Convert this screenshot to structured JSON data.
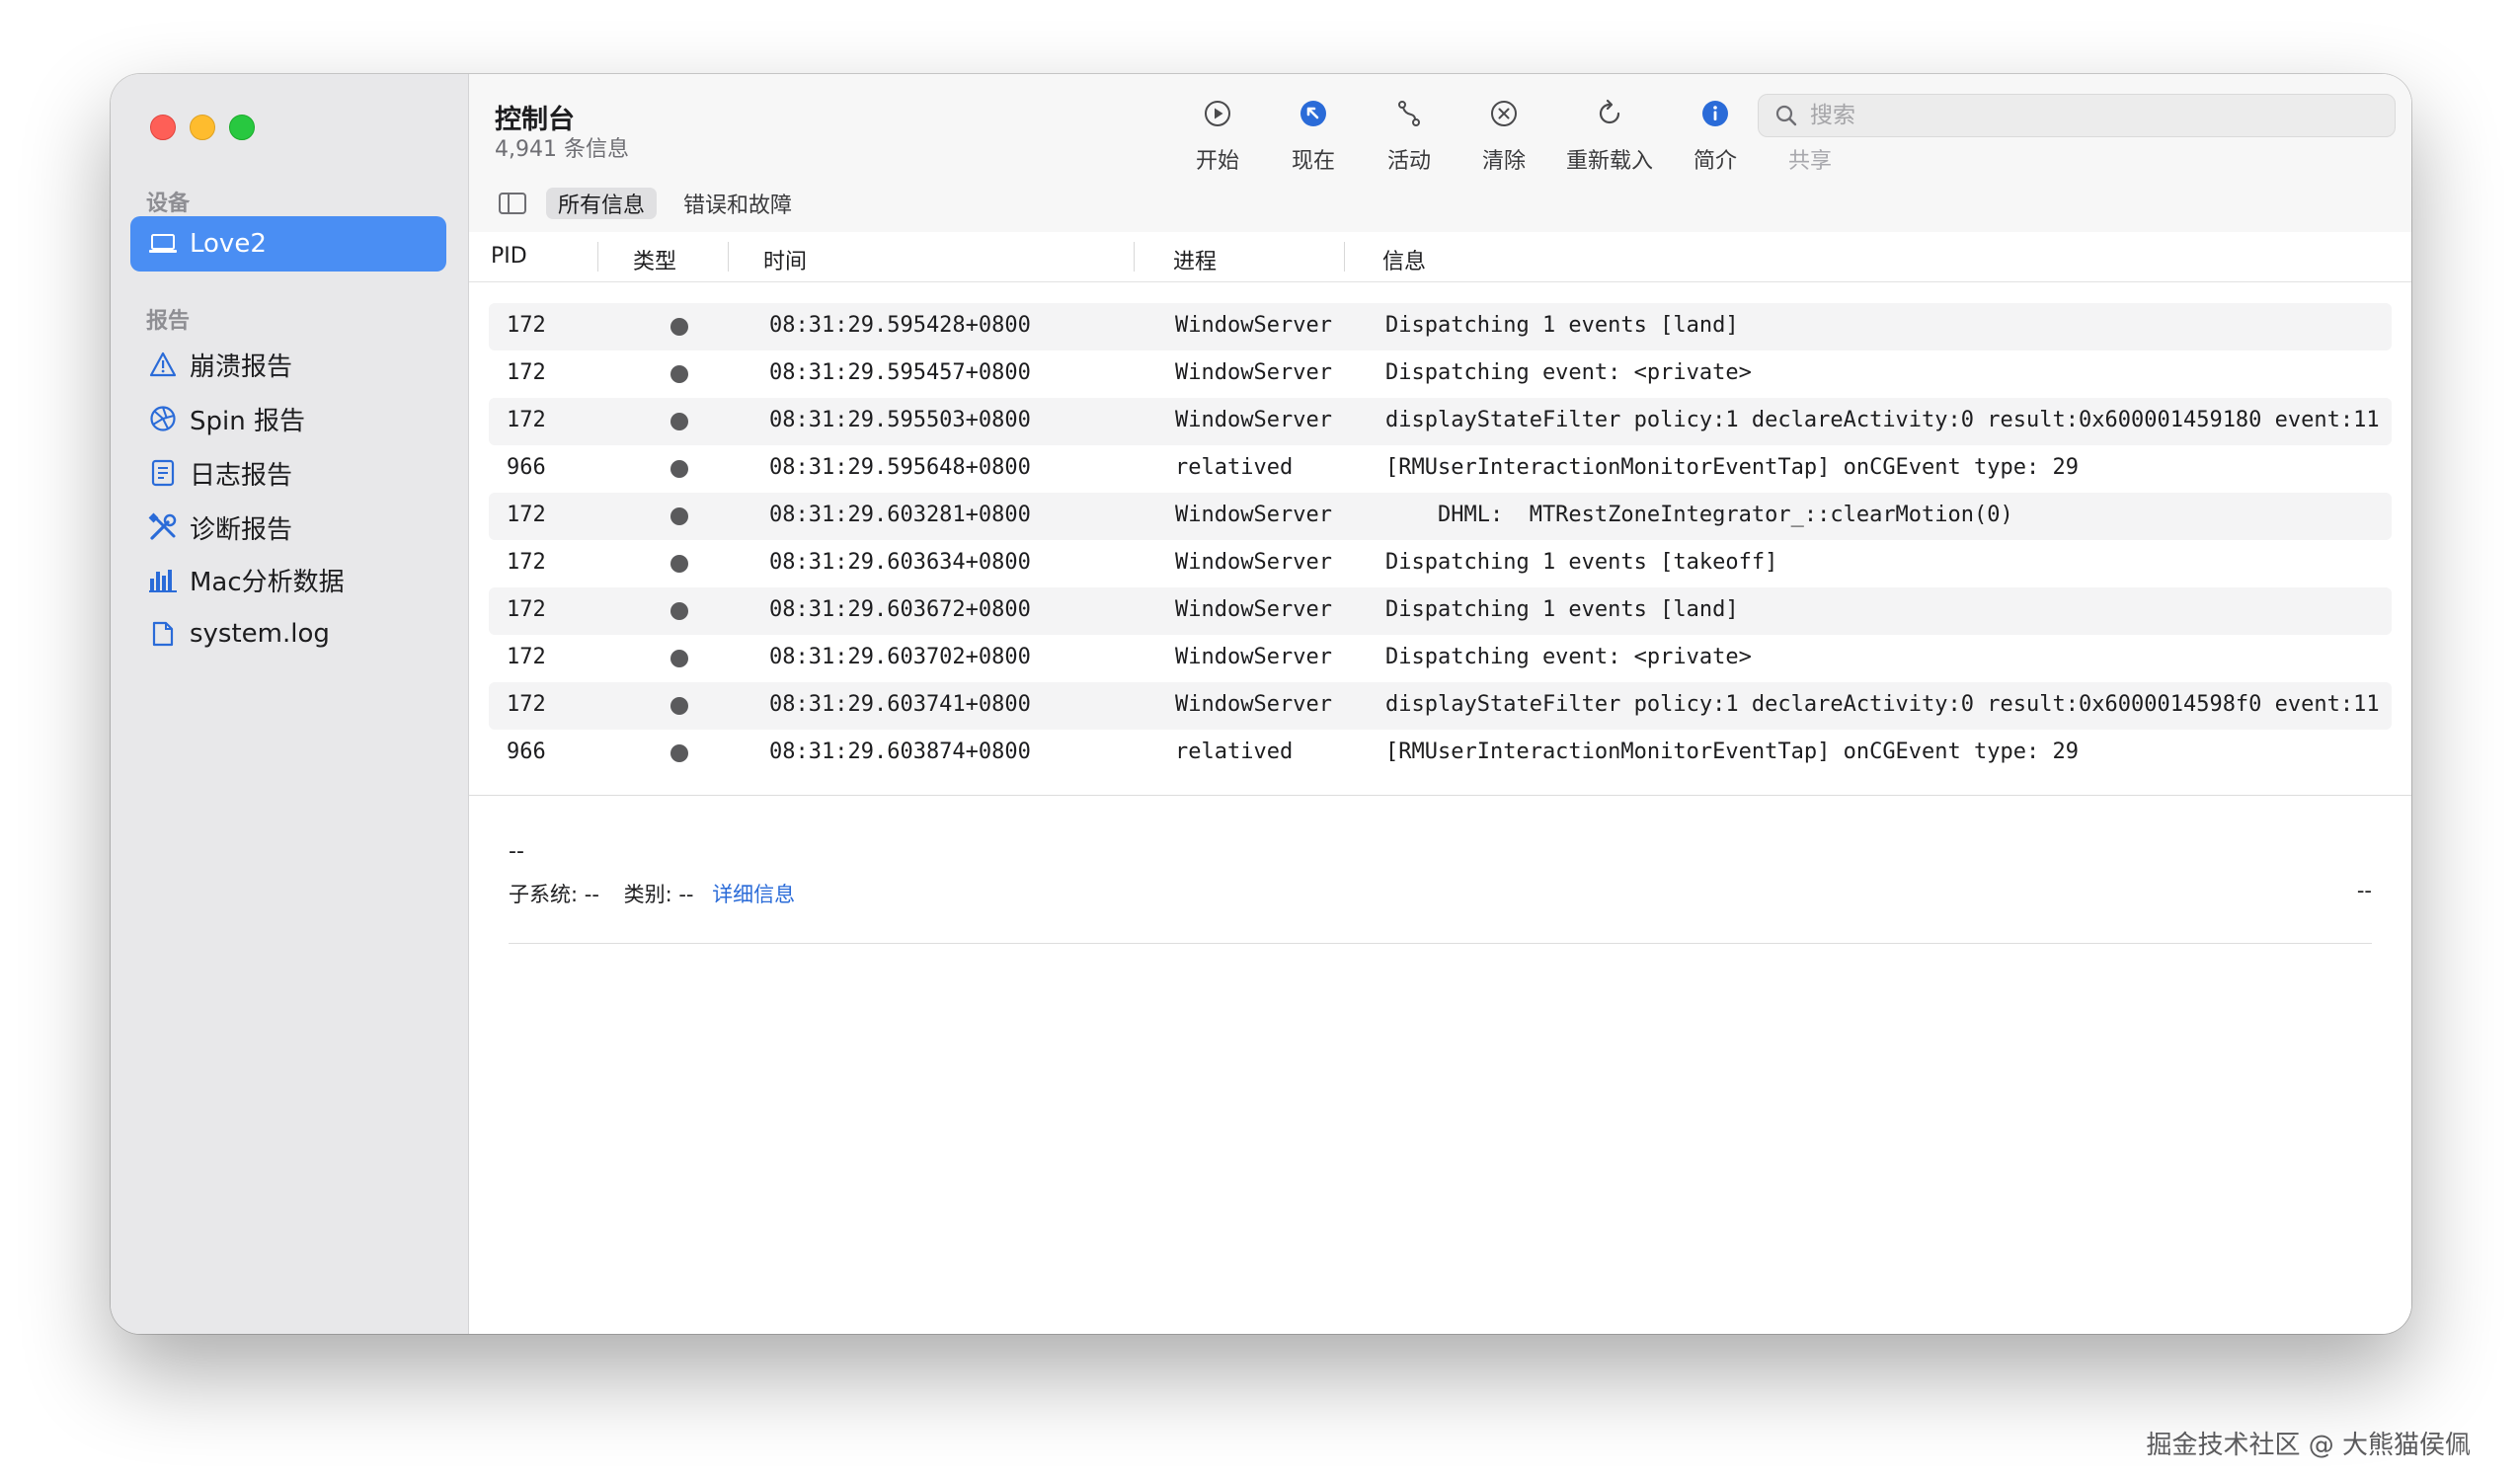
{
  "window": {
    "title": "控制台",
    "subtitle": "4,941 条信息"
  },
  "sidebar": {
    "devices_title": "设备",
    "device": {
      "label": "Love2",
      "icon": "laptop-icon"
    },
    "reports_title": "报告",
    "items": [
      {
        "label": "崩溃报告",
        "icon": "warning-triangle-icon"
      },
      {
        "label": "Spin 报告",
        "icon": "aperture-icon"
      },
      {
        "label": "日志报告",
        "icon": "document-text-icon"
      },
      {
        "label": "诊断报告",
        "icon": "tools-icon"
      },
      {
        "label": "Mac分析数据",
        "icon": "bar-chart-icon"
      },
      {
        "label": "system.log",
        "icon": "file-icon"
      }
    ]
  },
  "toolbar": {
    "buttons": [
      {
        "label": "开始",
        "icon": "play-circle-icon"
      },
      {
        "label": "现在",
        "icon": "arrow-up-left-circle-icon"
      },
      {
        "label": "活动",
        "icon": "activity-path-icon"
      },
      {
        "label": "清除",
        "icon": "clear-x-circle-icon"
      },
      {
        "label": "重新载入",
        "icon": "reload-icon"
      },
      {
        "label": "简介",
        "icon": "info-circle-icon"
      },
      {
        "label": "共享",
        "icon": "share-icon"
      }
    ],
    "search_placeholder": "搜索"
  },
  "filters": {
    "all": "所有信息",
    "errors": "错误和故障"
  },
  "table": {
    "headers": {
      "pid": "PID",
      "type": "类型",
      "time": "时间",
      "process": "进程",
      "message": "信息"
    },
    "rows": [
      {
        "pid": "172",
        "time": "08:31:29.595428+0800",
        "process": "WindowServer",
        "message": "Dispatching 1 events [land]"
      },
      {
        "pid": "172",
        "time": "08:31:29.595457+0800",
        "process": "WindowServer",
        "message": "Dispatching event: <private>"
      },
      {
        "pid": "172",
        "time": "08:31:29.595503+0800",
        "process": "WindowServer",
        "message": "displayStateFilter policy:1 declareActivity:0 result:0x600001459180 event:11"
      },
      {
        "pid": "966",
        "time": "08:31:29.595648+0800",
        "process": "relatived",
        "message": "[RMUserInteractionMonitorEventTap] onCGEvent type: 29"
      },
      {
        "pid": "172",
        "time": "08:31:29.603281+0800",
        "process": "WindowServer",
        "message": "    DHML:  MTRestZoneIntegrator_::clearMotion(0)"
      },
      {
        "pid": "172",
        "time": "08:31:29.603634+0800",
        "process": "WindowServer",
        "message": "Dispatching 1 events [takeoff]"
      },
      {
        "pid": "172",
        "time": "08:31:29.603672+0800",
        "process": "WindowServer",
        "message": "Dispatching 1 events [land]"
      },
      {
        "pid": "172",
        "time": "08:31:29.603702+0800",
        "process": "WindowServer",
        "message": "Dispatching event: <private>"
      },
      {
        "pid": "172",
        "time": "08:31:29.603741+0800",
        "process": "WindowServer",
        "message": "displayStateFilter policy:1 declareActivity:0 result:0x6000014598f0 event:11"
      },
      {
        "pid": "966",
        "time": "08:31:29.603874+0800",
        "process": "relatived",
        "message": "[RMUserInteractionMonitorEventTap] onCGEvent type: 29"
      }
    ]
  },
  "detail": {
    "dash": "--",
    "subsystem_label": "子系统: --",
    "category_label": "类别: --",
    "link": "详细信息",
    "right": "--"
  },
  "watermark": "掘金技术社区 @ 大熊猫侯佩",
  "colors": {
    "accent": "#4a8ef3",
    "sidebar": "#e8e8ea",
    "link": "#2a6bd8"
  }
}
